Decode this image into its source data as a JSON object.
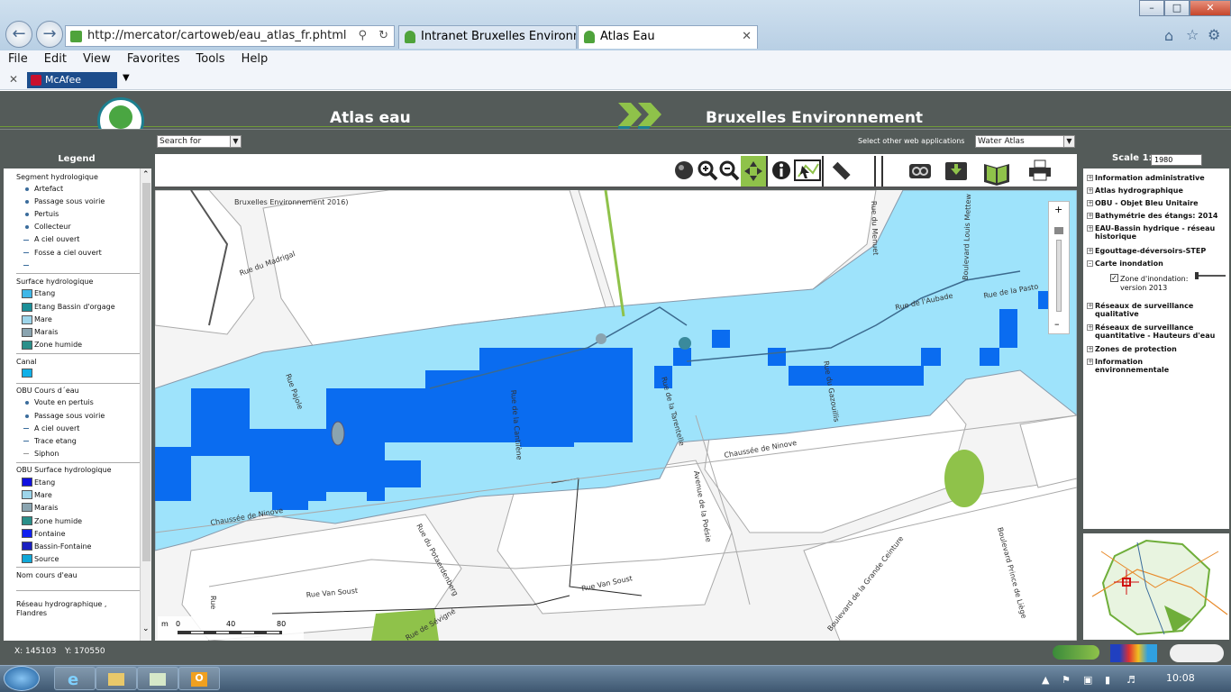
{
  "browser": {
    "address": "http://mercator/cartoweb/eau_atlas_fr.phtml",
    "tabs": [
      {
        "label": "Intranet Bruxelles Environneme..."
      },
      {
        "label": "Atlas Eau"
      }
    ],
    "menu": [
      "File",
      "Edit",
      "View",
      "Favorites",
      "Tools",
      "Help"
    ],
    "toolbar_addon": "McAfee"
  },
  "app": {
    "title_left": "Atlas eau",
    "title_right": "Bruxelles Environnement",
    "search_select": "Search for",
    "other_apps_label": "Select other web applications",
    "other_apps_value": "Water Atlas"
  },
  "legend": {
    "title": "Legend",
    "groups": [
      {
        "title": "Segment hydrologique",
        "items": [
          "Artefact",
          "Passage sous voirie",
          "Pertuis",
          "Collecteur",
          "A ciel ouvert",
          "Fosse a ciel ouvert"
        ]
      },
      {
        "title": "Surface hydrologique",
        "items": [
          "Etang",
          "Etang Bassin d'orgage",
          "Mare",
          "Marais",
          "Zone humide"
        ]
      },
      {
        "title": "Canal",
        "items": []
      },
      {
        "title": "OBU Cours d´eau",
        "items": [
          "Voute en pertuis",
          "Passage sous voirie",
          "A ciel ouvert",
          "Trace etang",
          "Siphon"
        ]
      },
      {
        "title": "OBU Surface hydrologique",
        "items": [
          "Etang",
          "Mare",
          "Marais",
          "Zone humide",
          "Fontaine",
          "Bassin-Fontaine",
          "Source"
        ]
      },
      {
        "title": "Nom cours d'eau",
        "items": []
      },
      {
        "title": "Réseau hydrographique , Flandres",
        "items": []
      }
    ]
  },
  "map": {
    "copyright": "Bruxelles Environnement 2016)",
    "streets": [
      "Rue du Madrigal",
      "Rue Pajole",
      "Rue de la Cantilène",
      "Rue de la Tarentelle",
      "Rue du Gazouillis",
      "Rue de l'Aubade",
      "Rue de la Pasto",
      "Rue du Menuet",
      "Boulevard Louis Mettew",
      "Chaussée de Ninove",
      "Chaussée de Ninove",
      "Avenue de la Poésie",
      "Rue du Potaerdenberg",
      "Rue Van Soust",
      "Rue Van Soust",
      "Boulevard de la Grande Ceinture",
      "Boulevard Prince de Liège",
      "Rue de Sévigné",
      "Rue"
    ],
    "scalebar": {
      "unit": "m",
      "ticks": [
        "0",
        "40",
        "80"
      ]
    },
    "colors": {
      "flood_light": "#9ee3fb",
      "flood_dark": "#0a6cf0",
      "park": "#8fc24a"
    }
  },
  "layers": {
    "scale_label": "Scale 1:",
    "scale_value": "1980",
    "items": [
      "Information administrative",
      "Atlas hydrographique",
      "OBU - Objet Bleu Unitaire",
      "Bathymétrie des étangs: 2014",
      "EAU-Bassin hydrique - réseau historique",
      "Egouttage-déversoirs-STEP",
      "Carte inondation",
      "Réseaux de surveillance qualitative",
      "Réseaux de surveillance quantitative - Hauteurs d'eau",
      "Zones de protection",
      "Information environnementale"
    ],
    "sublayer": "Zone d'inondation: version 2013"
  },
  "status": {
    "x": "X: 145103",
    "y": "Y: 170550"
  },
  "taskbar": {
    "time": "10:08"
  }
}
